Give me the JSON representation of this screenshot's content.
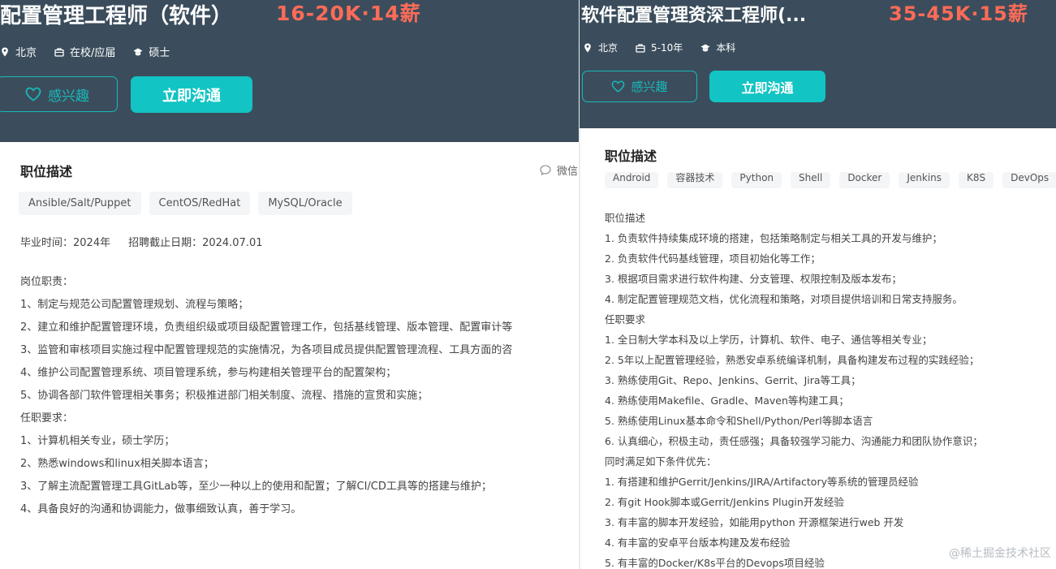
{
  "left": {
    "title": "配置管理工程师（软件）",
    "salary": "16-20K·14薪",
    "meta": {
      "location": "北京",
      "experience": "在校/应届",
      "degree": "硕士"
    },
    "buttons": {
      "interest": "感兴趣",
      "chat": "立即沟通"
    },
    "section_title": "职位描述",
    "share_label": "微信",
    "tags": [
      "Ansible/Salt/Puppet",
      "CentOS/RedHat",
      "MySQL/Oracle"
    ],
    "graduation": "毕业时间：2024年",
    "deadline": "招聘截止日期：2024.07.01",
    "lines": [
      "岗位职责：",
      "1、制定与规范公司配置管理规划、流程与策略；",
      "2、建立和维护配置管理环境，负责组织级或项目级配置管理工作，包括基线管理、版本管理、配置审计等",
      "3、监管和审核项目实施过程中配置管理规范的实施情况，为各项目成员提供配置管理流程、工具方面的咨",
      "4、维护公司配置管理系统、项目管理系统，参与构建相关管理平台的配置架构；",
      "5、协调各部门软件管理相关事务；积极推进部门相关制度、流程、措施的宣贯和实施；",
      "任职要求：",
      "1、计算机相关专业，硕士学历；",
      "2、熟悉windows和linux相关脚本语言；",
      "3、了解主流配置管理工具GitLab等，至少一种以上的使用和配置；了解CI/CD工具等的搭建与维护；",
      "4、具备良好的沟通和协调能力，做事细致认真，善于学习。"
    ]
  },
  "right": {
    "title": "软件配置管理资深工程师(...",
    "salary": "35-45K·15薪",
    "meta": {
      "location": "北京",
      "experience": "5-10年",
      "degree": "本科"
    },
    "buttons": {
      "interest": "感兴趣",
      "chat": "立即沟通"
    },
    "section_title": "职位描述",
    "tags": [
      "Android",
      "容器技术",
      "Python",
      "Shell",
      "Docker",
      "Jenkins",
      "K8S",
      "DevOps"
    ],
    "lines": [
      "职位描述",
      "1. 负责软件持续集成环境的搭建，包括策略制定与相关工具的开发与维护；",
      "2. 负责软件代码基线管理，项目初始化等工作；",
      "3. 根据项目需求进行软件构建、分支管理、权限控制及版本发布；",
      "4. 制定配置管理规范文档，优化流程和策略，对项目提供培训和日常支持服务。",
      "任职要求",
      "1. 全日制大学本科及以上学历，计算机、软件、电子、通信等相关专业；",
      "2. 5年以上配置管理经验，熟悉安卓系统编译机制，具备构建发布过程的实践经验；",
      "3. 熟练使用Git、Repo、Jenkins、Gerrit、Jira等工具；",
      "4. 熟练使用Makefile、Gradle、Maven等构建工具；",
      "5. 熟练使用Linux基本命令和Shell/Python/Perl等脚本语言",
      "6. 认真细心，积极主动，责任感强；具备较强学习能力、沟通能力和团队协作意识；",
      "同时满足如下条件优先：",
      "1. 有搭建和维护Gerrit/Jenkins/JIRA/Artifactory等系统的管理员经验",
      "2. 有git Hook脚本或Gerrit/Jenkins Plugin开发经验",
      "3. 有丰富的脚本开发经验，如能用python 开源框架进行web 开发",
      "4. 有丰富的安卓平台版本构建及发布经验",
      "5. 有丰富的Docker/K8s平台的Devops项目经验"
    ]
  },
  "watermark": "@稀土掘金技术社区",
  "icons": {
    "location": "location-pin-icon",
    "experience": "briefcase-icon",
    "degree": "graduation-cap-icon",
    "interest": "heart-outline-icon",
    "share": "chat-bubble-icon"
  },
  "colors": {
    "header_bg": "#3b4d5c",
    "salary": "#ff6b57",
    "accent": "#12c4c4"
  }
}
